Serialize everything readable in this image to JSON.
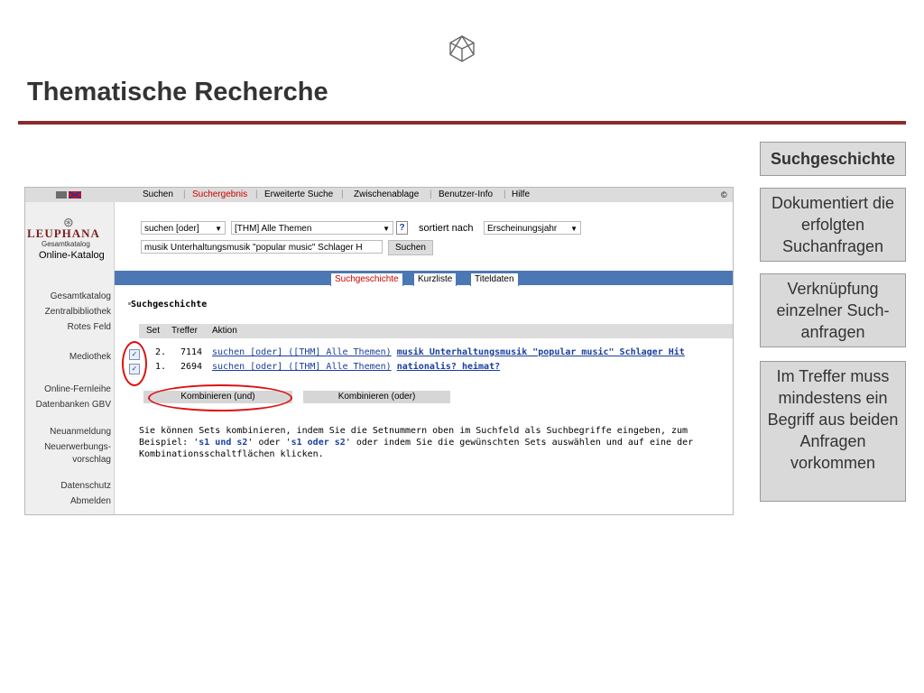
{
  "slide": {
    "title": "Thematische Recherche",
    "callouts": [
      "Suchgeschichte",
      "Dokumentiert die erfolgten Suchanfragen",
      "Verknüpfung einzelner Such-anfragen",
      "Im Treffer muss mindestens ein Begriff aus beiden Anfragen vorkommen"
    ]
  },
  "app": {
    "nav": [
      "Suchen",
      "Suchergebnis",
      "Erweiterte Suche",
      "Zwischenablage",
      "Benutzer-Info",
      "Hilfe"
    ],
    "copyright": "©",
    "brand": {
      "emblem": "⊛",
      "name": "LEUPHANA",
      "sub": "Gesamtkatalog",
      "title": "Online-Katalog"
    },
    "sidebar": [
      "Gesamtkatalog",
      "Zentralbibliothek",
      "Rotes Feld",
      "Mediothek",
      "Online-Fernleihe",
      "Datenbanken GBV",
      "Neuanmeldung",
      "Neuerwerbungs-",
      "vorschlag",
      "Datenschutz",
      "Abmelden"
    ],
    "search": {
      "mode": "suchen [oder]",
      "topic": "[THM] Alle Themen",
      "help": "?",
      "sort_label": "sortiert nach",
      "sort_value": "Erscheinungsjahr",
      "query": "musik Unterhaltungsmusik \"popular music\" Schlager H",
      "button": "Suchen"
    },
    "tabs": [
      "Suchgeschichte",
      "Kurzliste",
      "Titeldaten"
    ],
    "history": {
      "heading": "Suchgeschichte",
      "columns": [
        "Set",
        "Treffer",
        "Aktion"
      ],
      "rows": [
        {
          "set": "2.",
          "hits": "7114",
          "query": "suchen [oder] ([THM] Alle Themen)",
          "terms": "musik Unterhaltungsmusik \"popular music\" Schlager Hit",
          "checked": "✓"
        },
        {
          "set": "1.",
          "hits": "2694",
          "query": "suchen [oder] ([THM] Alle Themen)",
          "terms": "nationalis? heimat?",
          "checked": "✓"
        }
      ],
      "combine_and": "Kombinieren (und)",
      "combine_or": "Kombinieren (oder)",
      "help_text_1": "Sie können Sets kombinieren, indem Sie die Setnummern oben im Suchfeld als Suchbegriffe eingeben, zum Beispiel: '",
      "help_example_1": "s1 und s2",
      "help_text_2": "' oder '",
      "help_example_2": "s1 oder s2",
      "help_text_3": "' oder indem Sie die gewünschten Sets auswählen und auf eine der Kombinationsschaltflächen klicken."
    }
  },
  "colors": {
    "accent_rule": "#8b2b2b",
    "tab_bar": "#4b78b4",
    "annotation": "#dd1111",
    "link": "#1a3e9e"
  }
}
